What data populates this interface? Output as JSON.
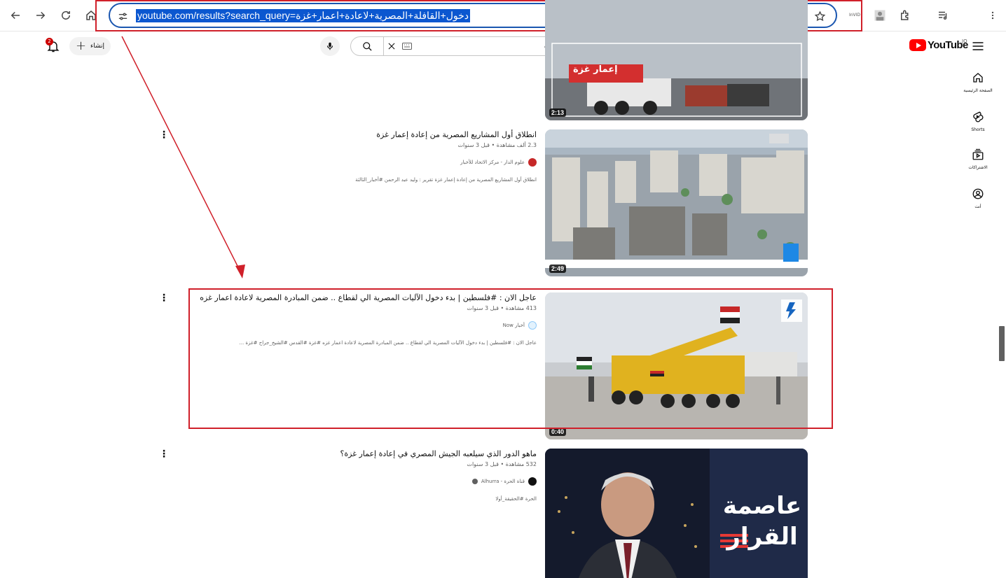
{
  "browser": {
    "url": "youtube.com/results?search_query=دخول+القافلة+المصرية+لاعادة+اعمار+غزة",
    "extension_label": "InVID",
    "icons": [
      "back-icon",
      "forward-icon",
      "reload-icon",
      "home-icon",
      "site-info-icon",
      "install-icon",
      "zoom-icon",
      "bookmark-star-icon",
      "profile-icon",
      "extensions-icon",
      "media-control-icon",
      "kebab-menu-icon"
    ]
  },
  "youtube": {
    "logo_text": "YouTube",
    "country_code": "JO",
    "search_query": "دخول القافلة المصرية لاعادة اعمار غزة",
    "create_label": "إنشاء",
    "notification_count": "2"
  },
  "guide": {
    "items": [
      {
        "label": "الصفحة الرئيسية",
        "icon": "home-icon"
      },
      {
        "label": "Shorts",
        "icon": "shorts-icon"
      },
      {
        "label": "الاشتراكات",
        "icon": "subscriptions-icon"
      },
      {
        "label": "أنت",
        "icon": "you-icon"
      }
    ]
  },
  "results": [
    {
      "duration": "2:13",
      "thumb_text": "إعمار غزة"
    },
    {
      "title": "انطلاق أول المشاريع المصرية من إعادة إعمار غزة",
      "meta": "2.3 ألف مشاهدة • قبل 3 سنوات",
      "channel": "علوم الدار - مركز الاتحاد للأخبار",
      "description": "انطلاق أول المشاريع المصرية من إعادة إعمار غزة تقرير : وليد عبد الرحمن #أخبار_الثالثة",
      "duration": "2:49",
      "channel_color": "#c62828"
    },
    {
      "title": "عاجل الان : #فلسطين | بدء دخول الآليات المصرية الي لقطاع .. ضمن المبادرة المصرية لاعادة اعمار غزه",
      "meta": "413 مشاهدة • قبل 3 سنوات",
      "channel": "أخبار Now",
      "description": "عاجل الان : #فلسطين | بدء دخول الآليات المصرية الي لقطاع .. ضمن المبادرة المصرية لاعادة اعمار غزه #غزة #القدس #الشيخ_جراح #غزة ...",
      "duration": "0:40",
      "channel_color": "#1565c0",
      "thumb_badge": "NOW"
    },
    {
      "title": "ماهو الدور الذي سيلعبه الجيش المصري في إعادة إعمار غزة؟",
      "meta": "532 مشاهدة • قبل 3 سنوات",
      "channel": "قناة الحرة - Alhurra",
      "description": "الحرة #الحقيقة_أولا",
      "channel_color": "#111111",
      "thumb_text_top": "عاصمة",
      "thumb_text_bottom": "القرار"
    }
  ],
  "colors": {
    "annotation_red": "#d0202a",
    "url_highlight": "#0b57d0",
    "yt_red": "#ff0000"
  }
}
